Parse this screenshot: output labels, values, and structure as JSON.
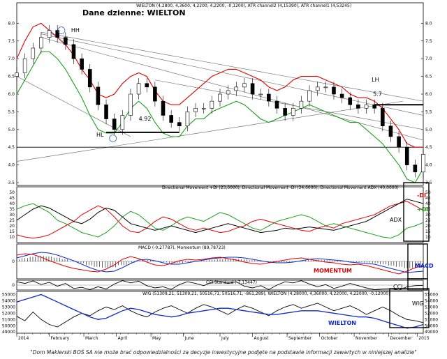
{
  "chart_data": [
    {
      "panel": "price",
      "type": "candlestick",
      "title": "Dane dzienne: WIELTON",
      "header": "WIELTON (4,2800, 4,3600, 4,2200, 4,2200, -0,1200), ATR channel2 (4,15390), ATR channel1 (4,53245)",
      "ylim": [
        3.5,
        8.5
      ],
      "yticks": [
        3.5,
        4.0,
        4.5,
        5.0,
        5.5,
        6.0,
        6.5,
        7.0,
        7.5,
        8.0
      ],
      "ytick_labels": [
        "3.5",
        "4.0",
        "4.5",
        "5.0",
        "5.5",
        "6.0",
        "6.5",
        "7.0",
        "7.5",
        "8.0"
      ],
      "x_months": [
        "2014",
        "February",
        "March",
        "April",
        "May",
        "June",
        "July",
        "August",
        "September",
        "October",
        "November",
        "December",
        "2015"
      ],
      "close_weekly": [
        6.6,
        7.0,
        7.3,
        7.6,
        7.8,
        7.6,
        7.4,
        7.0,
        6.7,
        6.2,
        5.7,
        5.3,
        5.0,
        5.4,
        6.0,
        6.3,
        6.2,
        5.8,
        5.4,
        5.2,
        5.1,
        5.5,
        5.6,
        5.6,
        5.8,
        6.0,
        6.1,
        6.2,
        6.3,
        6.0,
        6.0,
        5.8,
        5.6,
        5.4,
        5.6,
        5.8,
        6.1,
        6.2,
        6.2,
        6.0,
        5.9,
        5.7,
        5.6,
        5.7,
        5.6,
        5.1,
        4.8,
        4.5,
        4.0,
        3.8,
        4.3
      ],
      "atr_channel_upper": [
        7.0,
        7.5,
        7.9,
        8.0,
        7.8,
        7.6,
        7.4,
        7.1,
        6.7,
        6.4,
        6.0,
        5.9,
        6.0,
        6.3,
        6.5,
        6.6,
        6.5,
        6.1,
        5.8,
        5.7,
        5.7,
        5.9,
        6.1,
        6.3,
        6.5,
        6.6,
        6.7,
        6.7,
        6.6,
        6.5,
        6.4,
        6.2,
        6.1,
        6.2,
        6.4,
        6.5,
        6.5,
        6.5,
        6.4,
        6.3,
        6.2,
        6.0,
        5.9,
        5.9,
        5.8,
        5.6,
        5.3,
        5.0,
        4.6,
        4.5,
        4.5
      ],
      "atr_channel_lower": [
        6.0,
        6.4,
        6.8,
        7.2,
        7.2,
        7.0,
        6.7,
        6.3,
        5.9,
        5.4,
        5.0,
        4.9,
        4.9,
        5.2,
        5.6,
        5.8,
        5.6,
        5.2,
        4.9,
        4.8,
        4.8,
        5.1,
        5.3,
        5.3,
        5.5,
        5.6,
        5.7,
        5.8,
        5.7,
        5.5,
        5.3,
        5.2,
        5.3,
        5.4,
        5.5,
        5.6,
        5.7,
        5.6,
        5.5,
        5.4,
        5.3,
        5.2,
        5.2,
        5.0,
        4.8,
        4.6,
        4.3,
        4.0,
        3.6,
        3.5,
        3.9
      ],
      "support_level": 4.5,
      "annotations": [
        "HH",
        "HL",
        "4.92",
        "LH",
        "5.7"
      ]
    },
    {
      "panel": "dmi",
      "type": "line",
      "header": "Directional Movement +DI (23,0000), Directional Movement -DI (34,0000), Directional Movement ADX (40,0000)",
      "ylim": [
        5,
        55
      ],
      "yticks": [
        10,
        15,
        20,
        25,
        30,
        35,
        40,
        45,
        50
      ],
      "series": [
        {
          "name": "+DI",
          "color": "#1aa01a",
          "values": [
            35,
            38,
            40,
            36,
            32,
            25,
            22,
            18,
            14,
            12,
            10,
            14,
            20,
            28,
            33,
            30,
            24,
            18,
            16,
            20,
            25,
            28,
            26,
            24,
            28,
            32,
            30,
            26,
            22,
            18,
            16,
            20,
            24,
            26,
            28,
            30,
            28,
            24,
            20,
            22,
            20,
            18,
            16,
            14,
            12,
            10,
            9,
            12,
            18,
            20,
            23
          ]
        },
        {
          "name": "-DI",
          "color": "#e00000",
          "values": [
            12,
            10,
            9,
            10,
            12,
            16,
            20,
            24,
            30,
            34,
            38,
            35,
            28,
            20,
            15,
            14,
            18,
            24,
            28,
            26,
            22,
            18,
            16,
            18,
            16,
            14,
            15,
            18,
            20,
            24,
            26,
            24,
            22,
            20,
            18,
            16,
            15,
            18,
            20,
            18,
            22,
            24,
            26,
            28,
            30,
            34,
            38,
            40,
            42,
            38,
            34
          ]
        },
        {
          "name": "ADX",
          "color": "#000000",
          "values": [
            25,
            30,
            35,
            38,
            36,
            32,
            28,
            24,
            22,
            26,
            32,
            36,
            34,
            28,
            22,
            20,
            18,
            16,
            18,
            20,
            18,
            16,
            14,
            16,
            18,
            20,
            22,
            20,
            18,
            16,
            14,
            15,
            16,
            18,
            17,
            18,
            19,
            18,
            17,
            16,
            18,
            20,
            22,
            24,
            28,
            32,
            36,
            40,
            44,
            42,
            40
          ]
        }
      ],
      "labels": [
        "-DI",
        "ADX",
        "+DI"
      ]
    },
    {
      "panel": "macd",
      "type": "line",
      "header": "MACD (-0,27787), Momentum (89,78723)",
      "series": [
        {
          "name": "MACD",
          "color": "#0a2ad0",
          "values": [
            0.1,
            0.16,
            0.22,
            0.26,
            0.24,
            0.18,
            0.1,
            0.02,
            -0.08,
            -0.18,
            -0.26,
            -0.3,
            -0.28,
            -0.18,
            -0.06,
            0.04,
            0.06,
            0.02,
            -0.04,
            -0.08,
            -0.08,
            -0.04,
            0.0,
            0.04,
            0.08,
            0.1,
            0.12,
            0.12,
            0.1,
            0.06,
            0.02,
            -0.02,
            -0.04,
            -0.04,
            -0.02,
            0.02,
            0.06,
            0.08,
            0.06,
            0.04,
            0.02,
            -0.02,
            -0.04,
            -0.06,
            -0.08,
            -0.14,
            -0.2,
            -0.26,
            -0.32,
            -0.3,
            -0.28
          ]
        },
        {
          "name": "Momentum",
          "color": "#e00000",
          "values": [
            0.18,
            0.22,
            0.2,
            0.12,
            0.02,
            -0.06,
            -0.14,
            -0.2,
            -0.24,
            -0.28,
            -0.3,
            -0.22,
            -0.1,
            0.06,
            0.14,
            0.08,
            -0.02,
            -0.1,
            -0.12,
            -0.06,
            0.02,
            0.06,
            0.04,
            0.06,
            0.1,
            0.12,
            0.08,
            0.04,
            -0.02,
            -0.06,
            -0.08,
            -0.04,
            0.0,
            0.04,
            0.08,
            0.1,
            0.06,
            0.02,
            -0.02,
            -0.04,
            -0.08,
            -0.1,
            -0.08,
            -0.12,
            -0.18,
            -0.24,
            -0.3,
            -0.36,
            -0.28,
            -0.18,
            -0.12
          ]
        }
      ],
      "labels": [
        "MOMENTUM",
        "MACD"
      ]
    },
    {
      "panel": "cci",
      "type": "line",
      "header": "CCI Standard (-7,13447)",
      "series": [
        {
          "name": "CCI",
          "color": "#000000",
          "values": [
            120,
            60,
            150,
            20,
            100,
            -40,
            60,
            -120,
            -80,
            -160,
            -60,
            -140,
            40,
            160,
            80,
            140,
            -20,
            -100,
            -60,
            -150,
            20,
            120,
            60,
            -20,
            100,
            140,
            60,
            120,
            -40,
            -100,
            -20,
            -160,
            0,
            120,
            80,
            160,
            40,
            -60,
            20,
            -120,
            -40,
            60,
            -20,
            -100,
            -160,
            -140,
            -120,
            -180,
            -60,
            -20,
            -7
          ]
        }
      ],
      "labels": [
        "CCI"
      ]
    },
    {
      "panel": "wig",
      "type": "line",
      "header": "WIG (51309,21, 51309,21, 50516,71, 50516,71, -861,289), WIELTON (4,28000, 4,36000, 4,22000, 4,22000, -0,12000)",
      "y_right_ticks": [
        "55000",
        "54000",
        "53000",
        "52000",
        "51000",
        "50000",
        "49000"
      ],
      "y_left_ticks": [
        "55000",
        "54000",
        "53000",
        "52000",
        "51000",
        "50000",
        "49000"
      ],
      "series": [
        {
          "name": "WIG",
          "color": "#000000",
          "values": [
            51500,
            50800,
            52200,
            51000,
            50200,
            49800,
            50600,
            51400,
            52000,
            51600,
            52400,
            53000,
            52600,
            53200,
            52400,
            51800,
            51400,
            52200,
            52800,
            53200,
            52600,
            52000,
            52800,
            53400,
            53000,
            52400,
            51800,
            52600,
            53200,
            52800,
            52200,
            51600,
            52400,
            53000,
            53400,
            52800,
            53200,
            53600,
            53000,
            52400,
            52800,
            53200,
            52600,
            51800,
            52400,
            53000,
            52400,
            51600,
            51000,
            50800,
            50500
          ]
        },
        {
          "name": "WIELTON",
          "color": "#0a2ad0",
          "values": [
            53800,
            54200,
            54600,
            55000,
            54400,
            53800,
            53200,
            52600,
            52000,
            51400,
            51000,
            51200,
            51800,
            52400,
            52800,
            52600,
            52200,
            51800,
            51600,
            51400,
            51600,
            52000,
            52200,
            52400,
            52600,
            52800,
            52800,
            52600,
            52400,
            52200,
            52000,
            51800,
            51800,
            52000,
            52200,
            52400,
            52400,
            52400,
            52200,
            52000,
            51800,
            51600,
            51400,
            51400,
            51200,
            50800,
            50400,
            50000,
            49600,
            49800,
            50200
          ]
        }
      ],
      "labels": [
        "WIELTON",
        "WIG"
      ]
    }
  ],
  "footer": "\"Dom Maklerski BOŚ SA nie może brać odpowiedzialności za decyzje inwestycyjne podjęte na podstawie informacji zawartych w niniejszej analizie\""
}
